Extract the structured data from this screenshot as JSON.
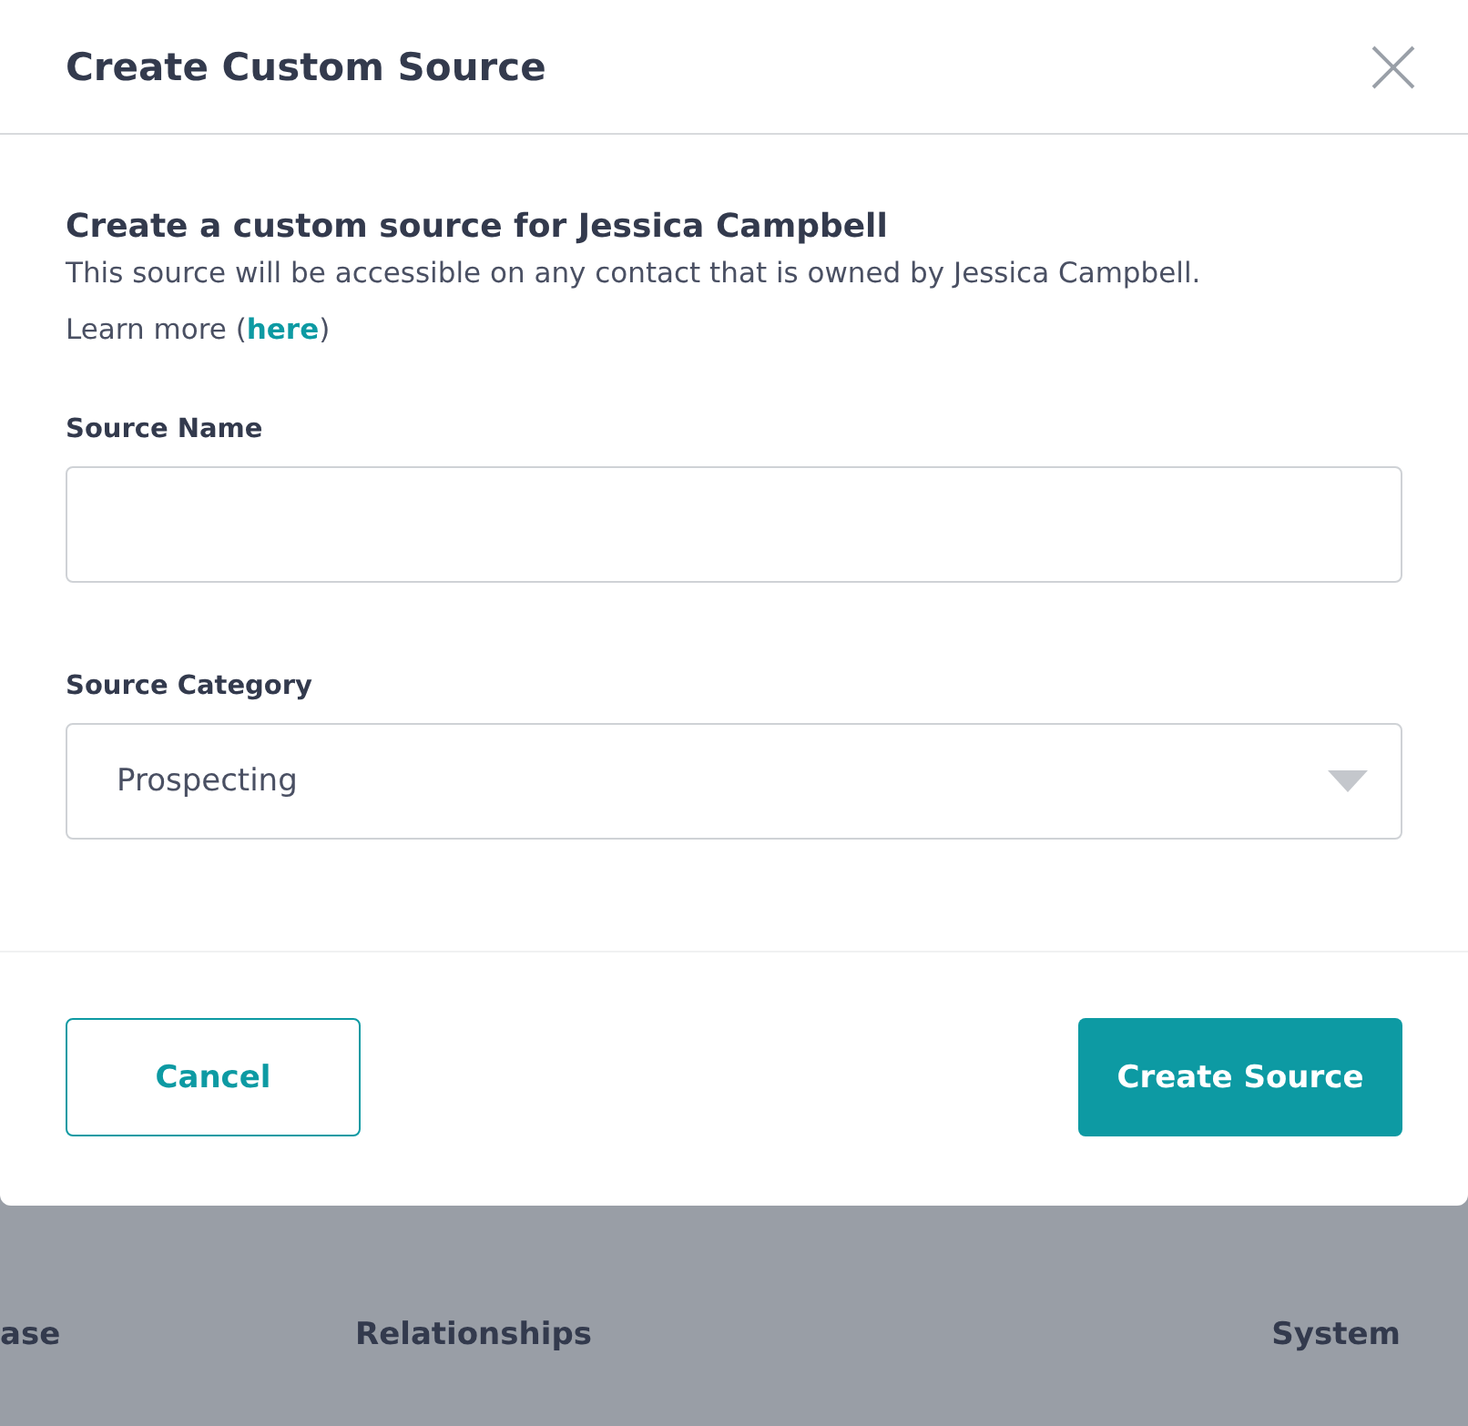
{
  "modal": {
    "title": "Create Custom Source",
    "heading": "Create a custom source for Jessica Campbell",
    "description": "This source will be accessible on any contact that is owned by Jessica Campbell.",
    "learn_more": {
      "before": "Learn more (",
      "link": "here",
      "after": ")"
    },
    "fields": [
      {
        "kind": "text",
        "label": "Source Name"
      },
      {
        "kind": "select",
        "label": "Source Category",
        "value": "Prospecting"
      }
    ],
    "buttons": [
      {
        "kind": "secondary",
        "label": "Cancel"
      },
      {
        "kind": "primary",
        "label": "Create Source"
      }
    ]
  },
  "background": {
    "labels": [
      "ase",
      "Relationships",
      "System"
    ]
  }
}
